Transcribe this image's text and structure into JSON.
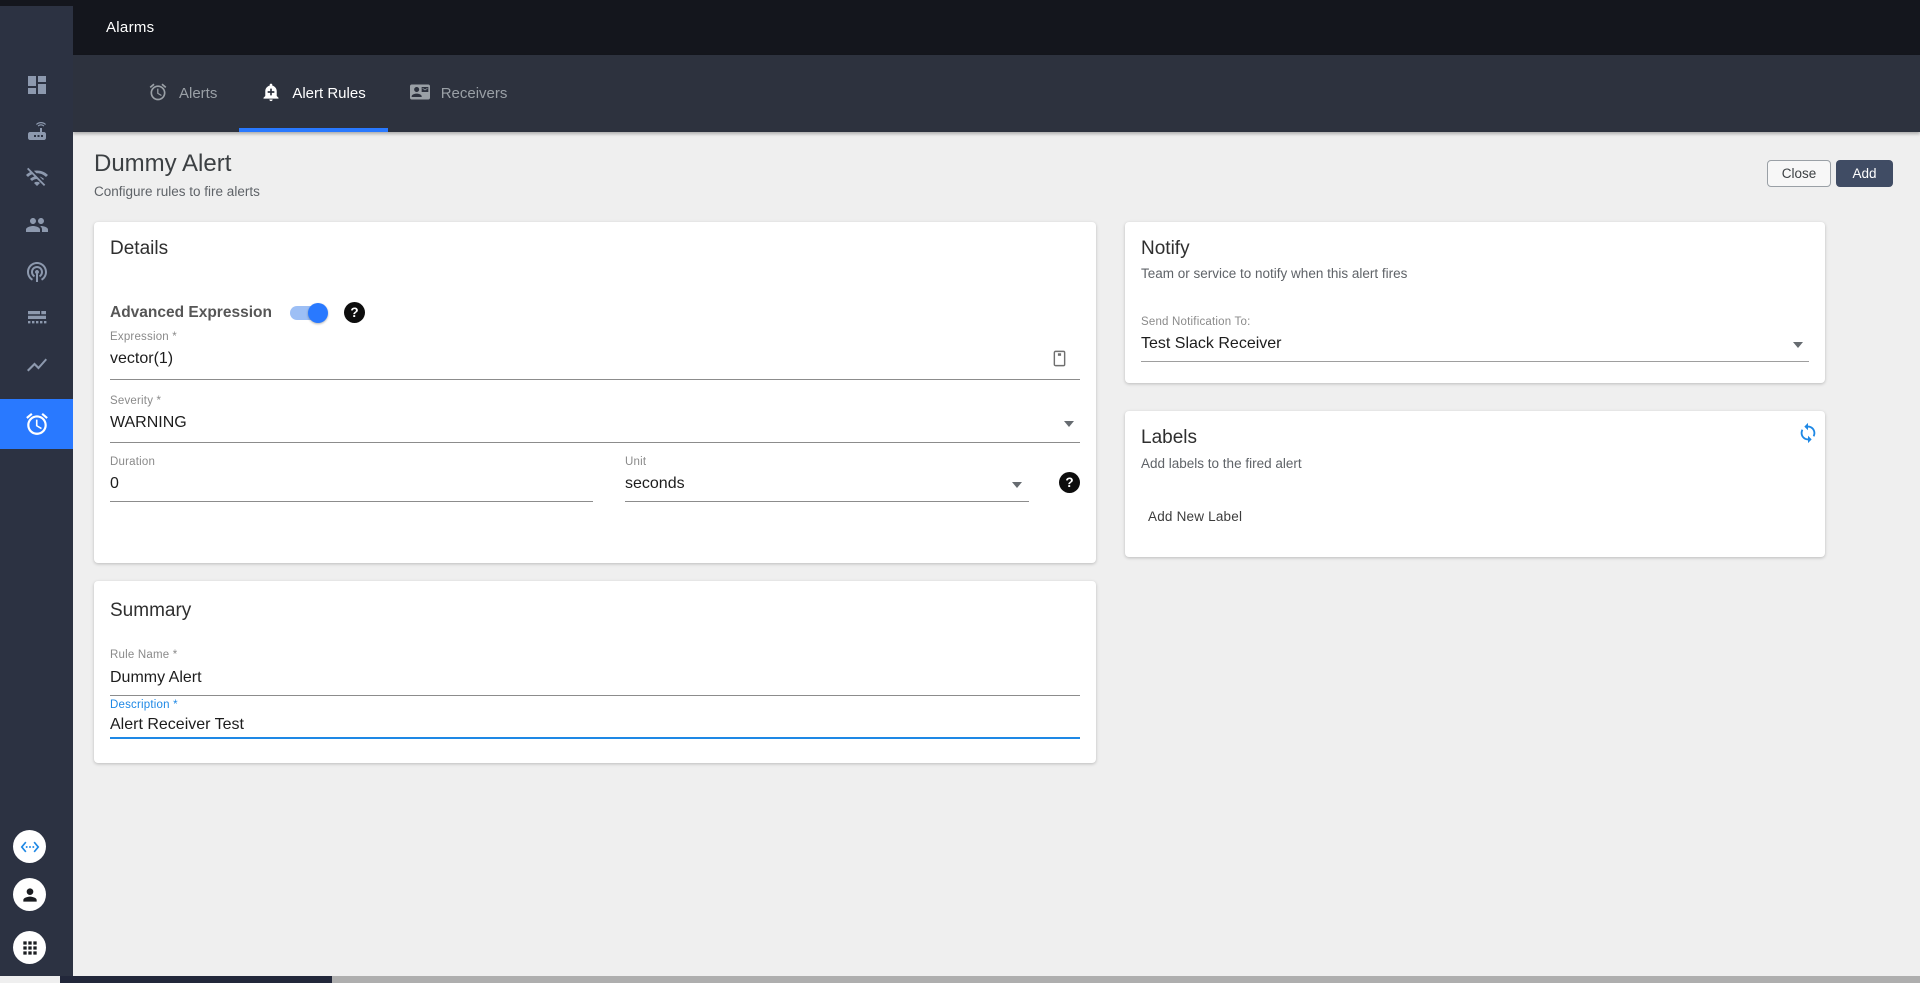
{
  "topbar": {
    "title": "Alarms"
  },
  "tab_bar": {
    "tabs": [
      {
        "label": "Alerts",
        "icon": "alarm-clock-icon",
        "active": false
      },
      {
        "label": "Alert Rules",
        "icon": "bell-plus-icon",
        "active": true
      },
      {
        "label": "Receivers",
        "icon": "contact-card-icon",
        "active": false
      }
    ],
    "active_underline_color": "#2979ff"
  },
  "sidebar": {
    "nav_icons": [
      "dashboard-icon",
      "router-icon",
      "wifi-off-icon",
      "users-icon",
      "podcasts-icon",
      "storage-rows-icon",
      "trend-chart-icon",
      "alarm-icon"
    ],
    "active_item": "alarm-icon",
    "bottom_icons": [
      "code-brackets-icon",
      "account-icon",
      "apps-grid-icon"
    ]
  },
  "page_header": {
    "title": "Dummy Alert",
    "subtitle": "Configure rules to fire alerts",
    "close_button": "Close",
    "add_button": "Add"
  },
  "details": {
    "title": "Details",
    "advanced_expression": {
      "label": "Advanced Expression",
      "enabled": true
    },
    "expression": {
      "label": "Expression *",
      "value": "vector(1)"
    },
    "severity": {
      "label": "Severity *",
      "value": "WARNING"
    },
    "duration": {
      "label": "Duration",
      "value": "0"
    },
    "unit": {
      "label": "Unit",
      "value": "seconds"
    }
  },
  "notify": {
    "title": "Notify",
    "subtitle": "Team or service to notify when this alert fires",
    "send_to": {
      "label": "Send Notification To:",
      "value": "Test Slack Receiver"
    }
  },
  "labels": {
    "title": "Labels",
    "subtitle": "Add labels to the fired alert",
    "add_label_button": "Add New Label"
  },
  "summary": {
    "title": "Summary",
    "rule_name": {
      "label": "Rule Name *",
      "value": "Dummy Alert"
    },
    "description": {
      "label": "Description *",
      "value": "Alert Receiver Test",
      "focused": true
    }
  },
  "icons": {
    "help_glyph": "?"
  },
  "colors": {
    "accent_blue": "#2979ff",
    "focus_blue": "#1e88e5",
    "add_button_bg": "#404c64",
    "topbar_bg": "#14161d",
    "tabbar_bg": "#2d323e",
    "sidebar_bg": "#2c3242",
    "page_bg": "#efefef"
  }
}
